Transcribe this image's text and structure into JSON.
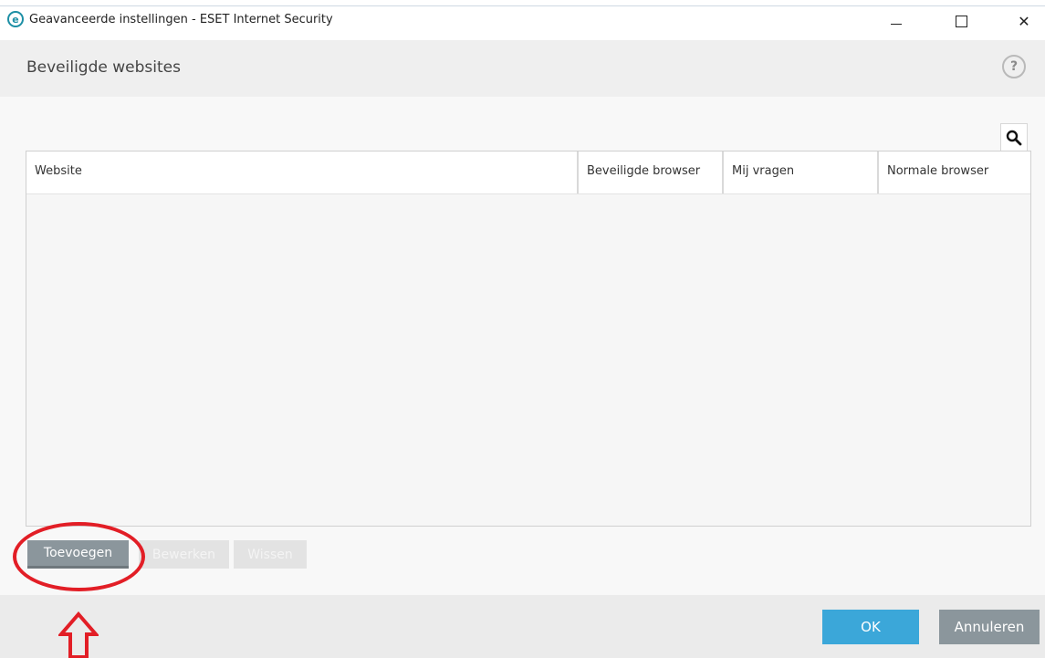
{
  "window": {
    "title": "Geavanceerde instellingen - ESET Internet Security",
    "logo_letter": "e",
    "controls": [
      "minimize-icon",
      "maximize-icon",
      "close-icon"
    ],
    "close_glyph": "✕"
  },
  "header": {
    "title": "Beveiligde websites",
    "help_glyph": "?"
  },
  "table": {
    "columns": [
      "Website",
      "Beveiligde browser",
      "Mij vragen",
      "Normale browser"
    ],
    "rows": []
  },
  "actions": {
    "add_label": "Toevoegen",
    "edit_label": "Bewerken",
    "delete_label": "Wissen"
  },
  "footer": {
    "ok_label": "OK",
    "cancel_label": "Annuleren"
  },
  "colors": {
    "accent_ok": "#3ba7d9",
    "secondary_button": "#8b969c",
    "annotation": "#e21e26"
  }
}
